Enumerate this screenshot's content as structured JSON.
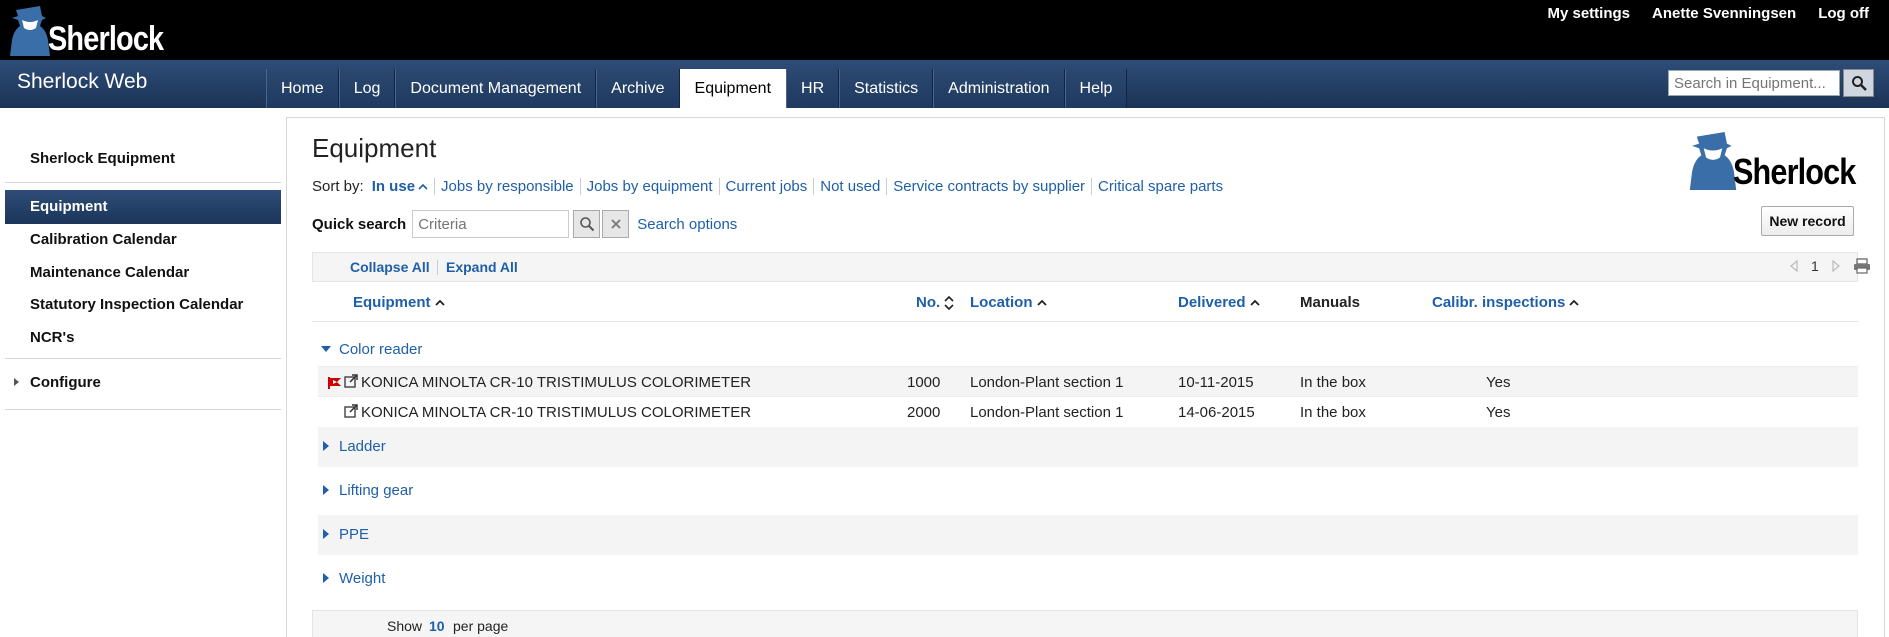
{
  "app": {
    "logo_text": "Sherlock",
    "brand": "Sherlock Web"
  },
  "top_links": [
    "My settings",
    "Anette Svenningsen",
    "Log off"
  ],
  "nav": {
    "tabs": [
      "Home",
      "Log",
      "Document Management",
      "Archive",
      "Equipment",
      "HR",
      "Statistics",
      "Administration",
      "Help"
    ],
    "active": "Equipment",
    "search_placeholder": "Search in Equipment..."
  },
  "sidebar": {
    "title": "Sherlock Equipment",
    "items": [
      "Equipment",
      "Calibration Calendar",
      "Maintenance Calendar",
      "Statutory Inspection Calendar",
      "NCR's"
    ],
    "configure": "Configure"
  },
  "main": {
    "title": "Equipment",
    "logo_text": "Sherlock",
    "sort_label": "Sort by:",
    "sort_options": [
      "In use",
      "Jobs by responsible",
      "Jobs by equipment",
      "Current jobs",
      "Not used",
      "Service contracts by supplier",
      "Critical spare parts"
    ],
    "quick_search_label": "Quick search",
    "quick_search_placeholder": "Criteria",
    "search_options": "Search options",
    "new_record": "New record",
    "collapse_all": "Collapse All",
    "expand_all": "Expand All",
    "page": "1",
    "columns": [
      "Equipment",
      "No.",
      "Location",
      "Delivered",
      "Manuals",
      "Calibr. inspections"
    ],
    "groups": [
      {
        "name": "Color reader",
        "expanded": true
      },
      {
        "name": "Ladder",
        "expanded": false
      },
      {
        "name": "Lifting gear",
        "expanded": false
      },
      {
        "name": "PPE",
        "expanded": false
      },
      {
        "name": "Weight",
        "expanded": false
      }
    ],
    "rows": [
      {
        "name": "KONICA MINOLTA CR-10 TRISTIMULUS COLORIMETER",
        "no": "1000",
        "location": "London-Plant section 1",
        "delivered": "10-11-2015",
        "manuals": "In the box",
        "calibr": "Yes",
        "flag": true
      },
      {
        "name": "KONICA MINOLTA CR-10 TRISTIMULUS COLORIMETER",
        "no": "2000",
        "location": "London-Plant section 1",
        "delivered": "14-06-2015",
        "manuals": "In the box",
        "calibr": "Yes",
        "flag": false
      }
    ],
    "footer": {
      "show": "Show",
      "per_page_value": "10",
      "per_page": "per page"
    }
  },
  "colors": {
    "link": "#1f5fa8",
    "nav": "#1f3a60",
    "topbar": "#000000"
  }
}
